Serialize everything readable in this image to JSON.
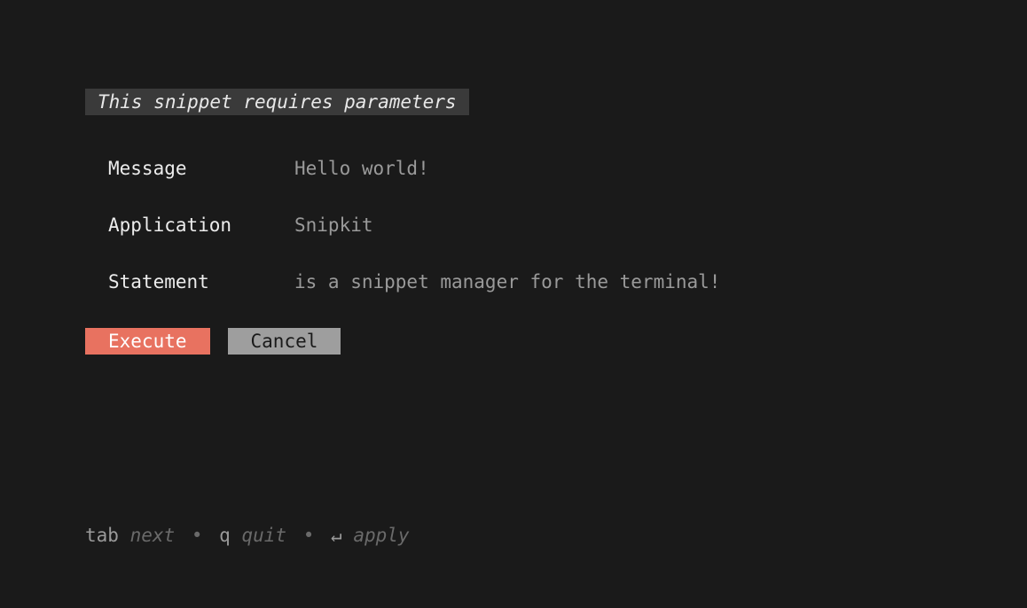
{
  "title": "This snippet requires parameters",
  "fields": [
    {
      "label": "Message",
      "value": "Hello world!"
    },
    {
      "label": "Application",
      "value": "Snipkit"
    },
    {
      "label": "Statement",
      "value": "is a snippet manager for the terminal!"
    }
  ],
  "buttons": {
    "execute": "Execute",
    "cancel": "Cancel"
  },
  "hints": {
    "tab_key": "tab",
    "tab_action": "next",
    "q_key": "q",
    "q_action": "quit",
    "enter_icon": "↵",
    "enter_action": "apply"
  }
}
